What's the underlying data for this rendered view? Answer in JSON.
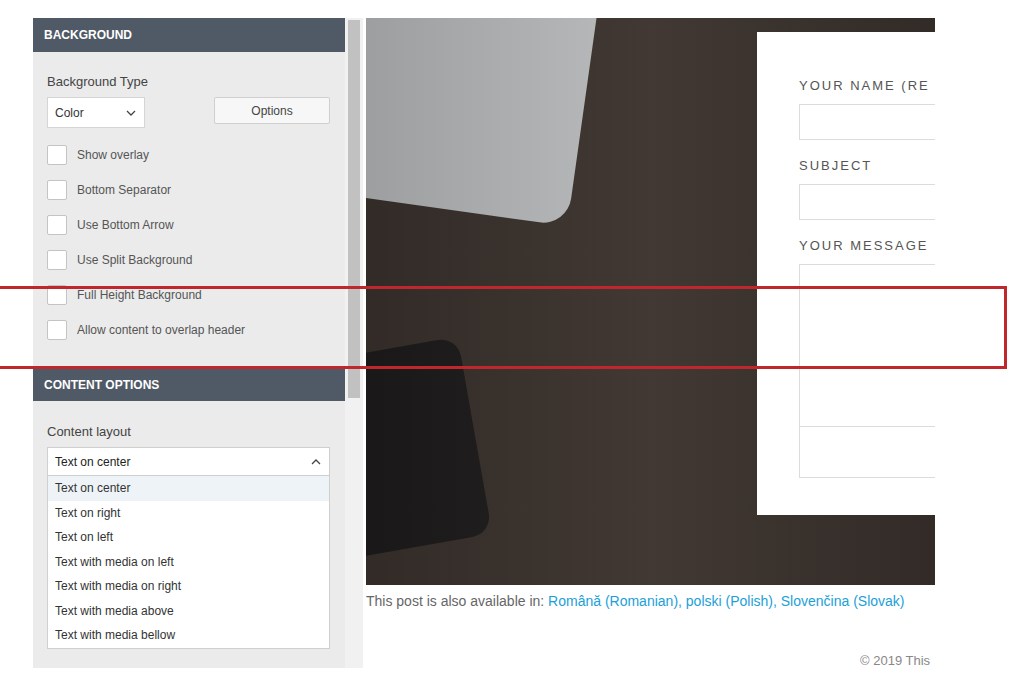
{
  "settings_panel": {
    "background_header": "BACKGROUND",
    "background_type_label": "Background Type",
    "background_type_value": "Color",
    "options_button": "Options",
    "checkboxes": [
      {
        "label": "Show overlay",
        "checked": false
      },
      {
        "label": "Bottom Separator",
        "checked": false
      },
      {
        "label": "Use Bottom Arrow",
        "checked": false
      },
      {
        "label": "Use Split Background",
        "checked": false
      },
      {
        "label": "Full Height Background",
        "checked": false
      },
      {
        "label": "Allow content to overlap header",
        "checked": false
      }
    ],
    "content_header": "CONTENT OPTIONS",
    "content_layout_label": "Content layout",
    "content_layout_value": "Text on center",
    "dropdown_options": [
      {
        "label": "Text on center",
        "selected": true,
        "annotated": false
      },
      {
        "label": "Text on right",
        "selected": false,
        "annotated": false
      },
      {
        "label": "Text on left",
        "selected": false,
        "annotated": false
      },
      {
        "label": "Text with media on left",
        "selected": false,
        "annotated": true
      },
      {
        "label": "Text with media on right",
        "selected": false,
        "annotated": true
      },
      {
        "label": "Text with media above",
        "selected": false,
        "annotated": true
      },
      {
        "label": "Text with media bellow",
        "selected": false,
        "annotated": true
      }
    ]
  },
  "contact_form": {
    "fields": [
      {
        "label": "YOUR NAME (RE",
        "kind": "input"
      },
      {
        "label": "SUBJECT",
        "kind": "input"
      },
      {
        "label": "YOUR MESSAGE",
        "kind": "textarea"
      }
    ]
  },
  "languages": {
    "prefix": "This post is also available in: ",
    "separator": ", ",
    "links": [
      "Română (Romanian)",
      "polski (Polish)",
      "Slovenčina (Slovak)"
    ]
  },
  "footer": "© 2019 This"
}
